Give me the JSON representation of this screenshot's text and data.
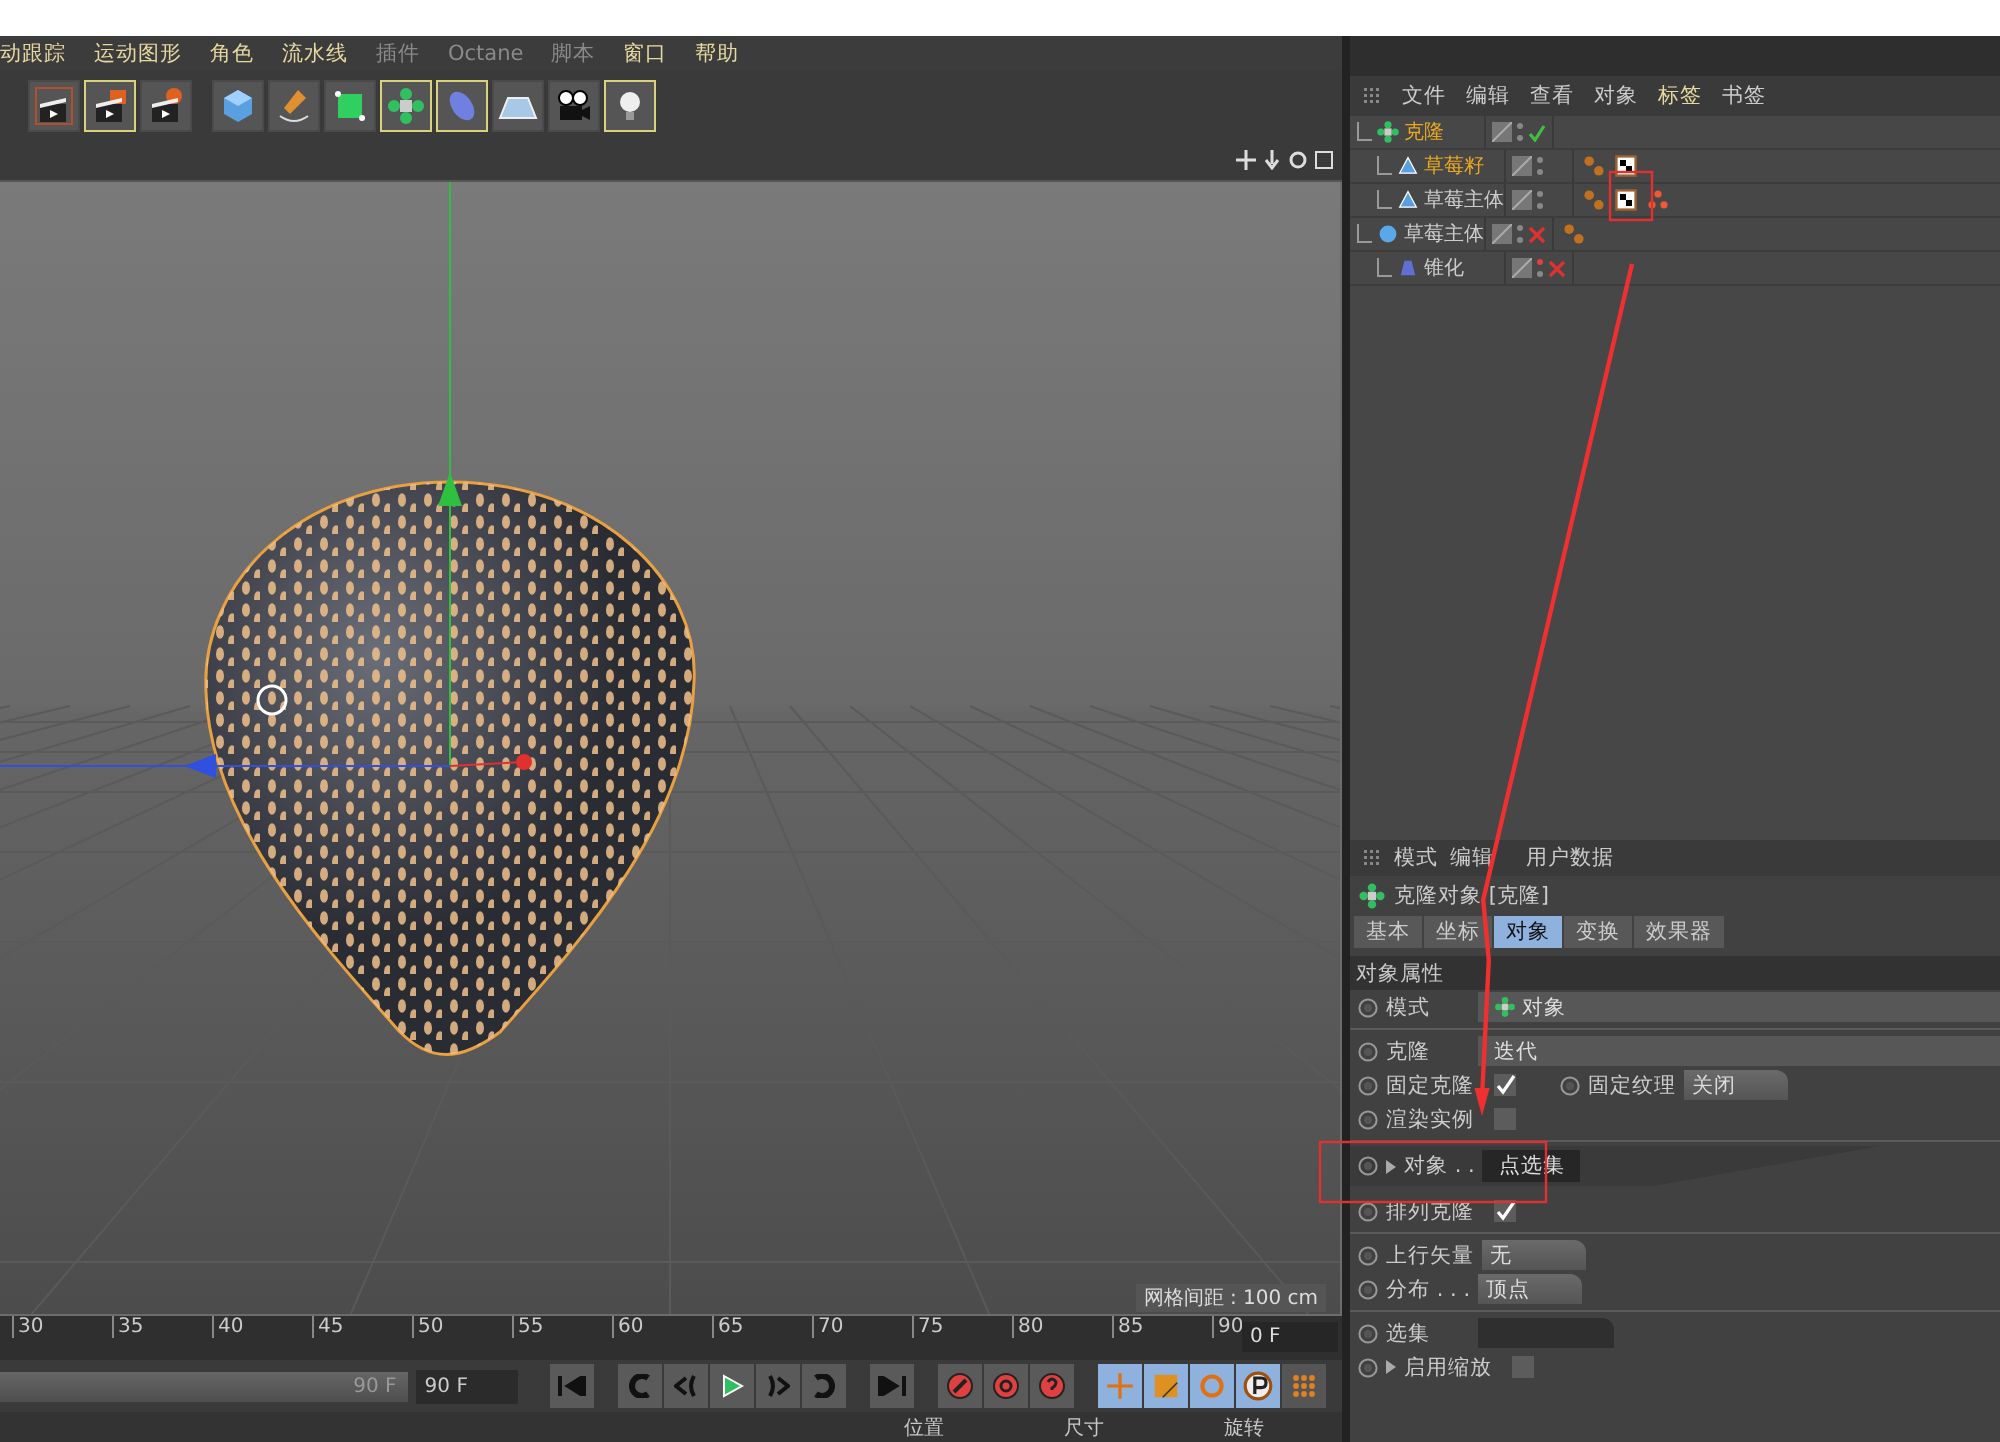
{
  "menu": [
    {
      "label": "动跟踪",
      "disabled": false
    },
    {
      "label": "运动图形",
      "disabled": false
    },
    {
      "label": "角色",
      "disabled": false
    },
    {
      "label": "流水线",
      "disabled": false
    },
    {
      "label": "插件",
      "disabled": true
    },
    {
      "label": "Octane",
      "disabled": true
    },
    {
      "label": "脚本",
      "disabled": true
    },
    {
      "label": "窗口",
      "disabled": false
    },
    {
      "label": "帮助",
      "disabled": false
    }
  ],
  "toolbar": [
    {
      "kind": "render-view",
      "selected": false
    },
    {
      "kind": "render",
      "selected": true
    },
    {
      "kind": "render-settings",
      "selected": false
    },
    {
      "kind": "cube",
      "selected": false
    },
    {
      "kind": "pen",
      "selected": false
    },
    {
      "kind": "subdivision",
      "selected": false
    },
    {
      "kind": "cloner",
      "selected": true
    },
    {
      "kind": "deformer",
      "selected": true
    },
    {
      "kind": "floor",
      "selected": false
    },
    {
      "kind": "camera",
      "selected": false
    },
    {
      "kind": "light",
      "selected": true
    }
  ],
  "viewport": {
    "grid_label": "网格间距 : 100 cm"
  },
  "timeline": {
    "ticks": [
      "30",
      "35",
      "40",
      "45",
      "50",
      "55",
      "60",
      "65",
      "70",
      "75",
      "80",
      "85",
      "90"
    ],
    "current_frame": "0 F",
    "range": {
      "label": "90 F",
      "level": 1
    },
    "end_frame": "90 F",
    "keys": [
      {
        "kind": "move",
        "selected": true
      },
      {
        "kind": "scale",
        "selected": true
      },
      {
        "kind": "rotate",
        "selected": true
      },
      {
        "kind": "param",
        "selected": true
      },
      {
        "kind": "points",
        "selected": false
      }
    ],
    "coord_headers": [
      "位置",
      "尺寸",
      "旋转"
    ]
  },
  "object_manager": {
    "menu": [
      {
        "label": "文件",
        "selected": false
      },
      {
        "label": "编辑",
        "selected": false
      },
      {
        "label": "查看",
        "selected": false
      },
      {
        "label": "对象",
        "selected": false
      },
      {
        "label": "标签",
        "selected": true
      },
      {
        "label": "书签",
        "selected": false
      }
    ],
    "objects": [
      {
        "name": "克隆",
        "kind": "cloner",
        "selected": true,
        "enabled": true,
        "children": [
          {
            "name": "草莓籽",
            "kind": "polygon",
            "selected": true,
            "tags": [
              {
                "kind": "phong"
              },
              {
                "kind": "material"
              }
            ]
          },
          {
            "name": "草莓主体",
            "kind": "polygon",
            "selected": false,
            "tags": [
              {
                "kind": "phong"
              },
              {
                "kind": "material"
              },
              {
                "kind": "point-selection"
              }
            ]
          }
        ]
      },
      {
        "name": "草莓主体",
        "kind": "sphere",
        "selected": false,
        "enabled": false,
        "tags": [
          {
            "kind": "phong"
          }
        ],
        "children": [
          {
            "name": "锥化",
            "kind": "taper",
            "selected": false,
            "enabled": false
          }
        ]
      }
    ]
  },
  "attributes": {
    "menu": [
      "模式",
      "编辑",
      "用户数据"
    ],
    "title": "克隆对象 [克隆]",
    "tabs": [
      {
        "label": "基本",
        "selected": false
      },
      {
        "label": "坐标",
        "selected": false
      },
      {
        "label": "对象",
        "selected": true
      },
      {
        "label": "变换",
        "selected": false
      },
      {
        "label": "效果器",
        "selected": false
      }
    ],
    "section": "对象属性",
    "rows": [
      {
        "kind": "mode",
        "label": "模式",
        "value": "对象"
      },
      {
        "kind": "separator"
      },
      {
        "kind": "field",
        "label": "克隆",
        "value": "迭代"
      },
      {
        "kind": "pair",
        "label": "固定克隆",
        "checked": true,
        "label2": "固定纹理",
        "value2": "关闭"
      },
      {
        "kind": "checkbox",
        "label": "渲染实例",
        "checked": false
      },
      {
        "kind": "separator"
      },
      {
        "kind": "link",
        "label": "对象 . .",
        "value": "点选集"
      },
      {
        "kind": "checkbox",
        "label": "排列克隆",
        "checked": true
      },
      {
        "kind": "separator"
      },
      {
        "kind": "dropdown",
        "label": "上行矢量",
        "value": "无"
      },
      {
        "kind": "dropdown",
        "label": "分布 . . .",
        "value": "顶点"
      },
      {
        "kind": "separator"
      },
      {
        "kind": "empty-dropdown",
        "label": "选集"
      },
      {
        "kind": "checkbox-group",
        "label": "启用缩放",
        "checked": false
      }
    ]
  }
}
